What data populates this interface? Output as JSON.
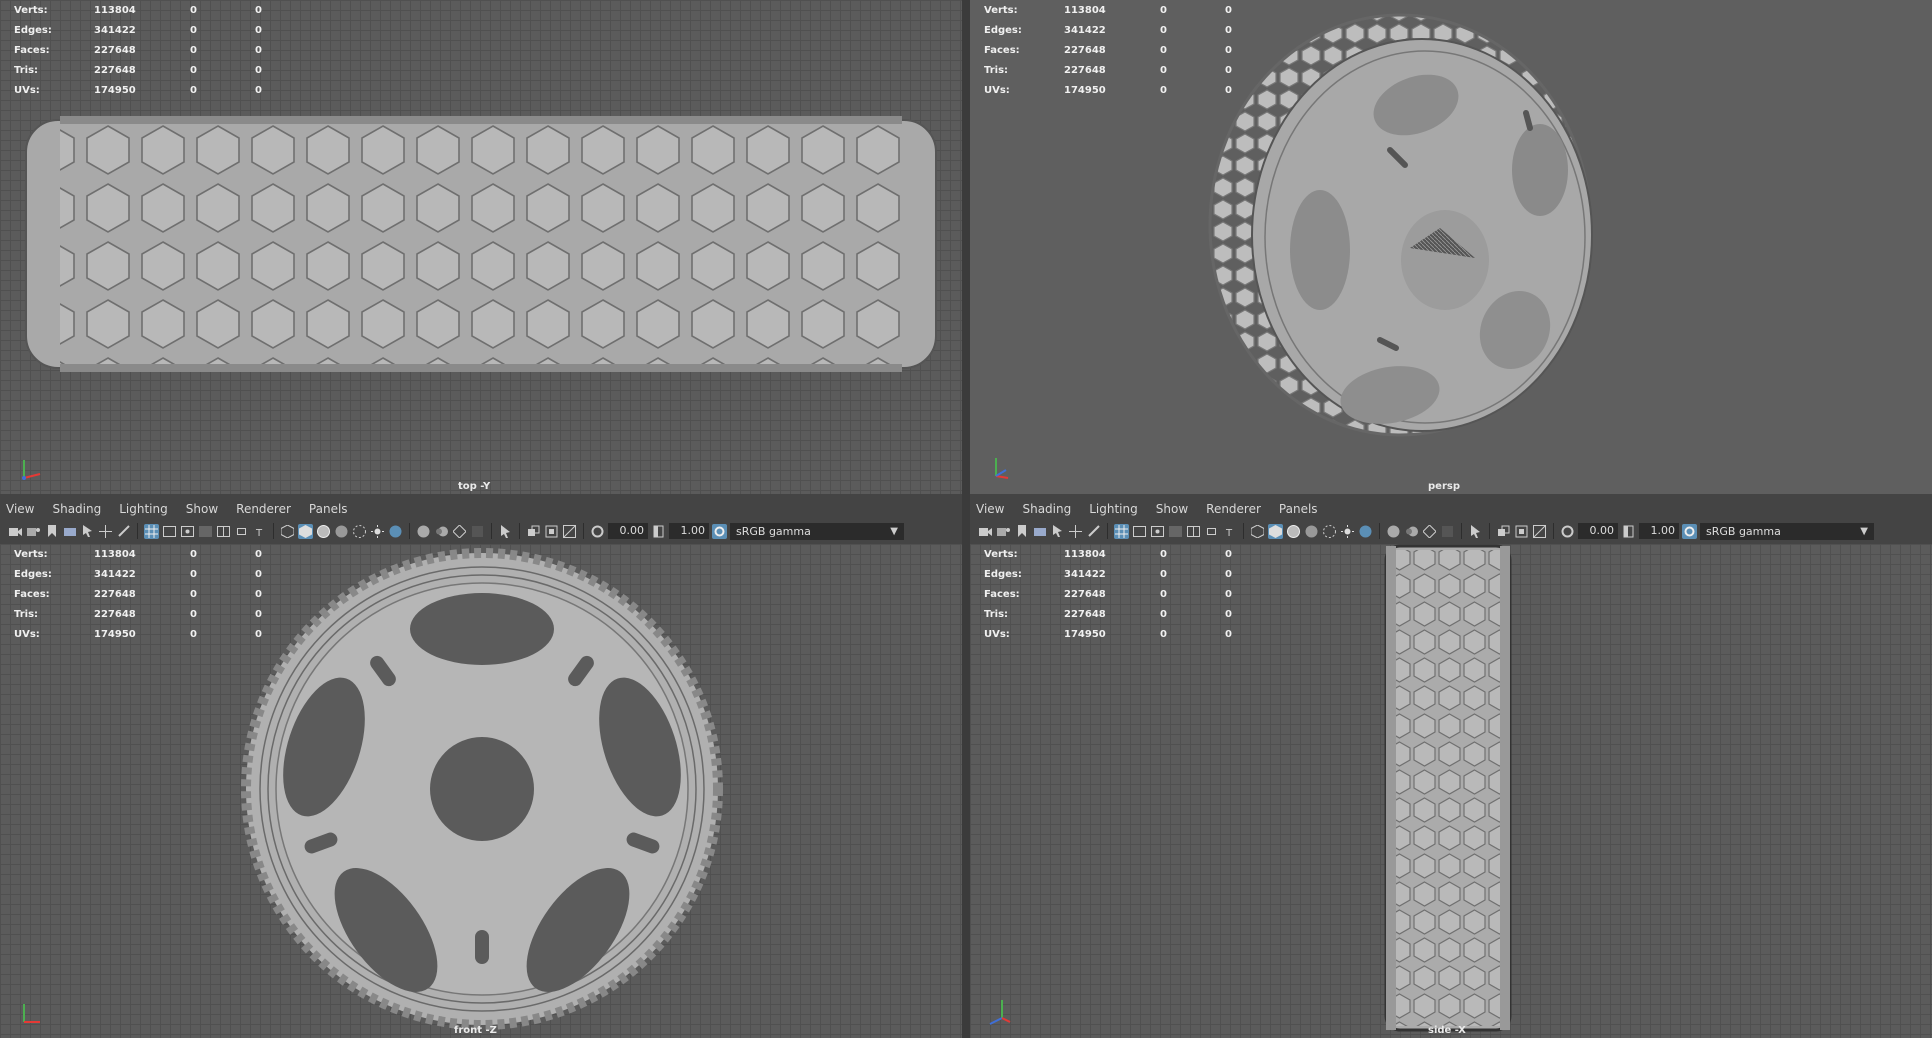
{
  "menu": [
    "View",
    "Shading",
    "Lighting",
    "Show",
    "Renderer",
    "Panels"
  ],
  "toolbar": {
    "exposure": "0.00",
    "gamma": "1.00",
    "color_space": "sRGB gamma"
  },
  "hud": [
    {
      "label": "Verts:",
      "value": "113804",
      "a": "0",
      "b": "0"
    },
    {
      "label": "Edges:",
      "value": "341422",
      "a": "0",
      "b": "0"
    },
    {
      "label": "Faces:",
      "value": "227648",
      "a": "0",
      "b": "0"
    },
    {
      "label": "Tris:",
      "value": "227648",
      "a": "0",
      "b": "0"
    },
    {
      "label": "UVs:",
      "value": "174950",
      "a": "0",
      "b": "0"
    }
  ],
  "viewports": {
    "top": "top -Y",
    "persp": "persp",
    "front": "front -Z",
    "side": "side -X"
  },
  "colors": {
    "accent": "#5b8fb6",
    "model": "#b4b4b4",
    "grid_bg": "#5b5b5b",
    "persp_bg": "#5f5f5f"
  }
}
